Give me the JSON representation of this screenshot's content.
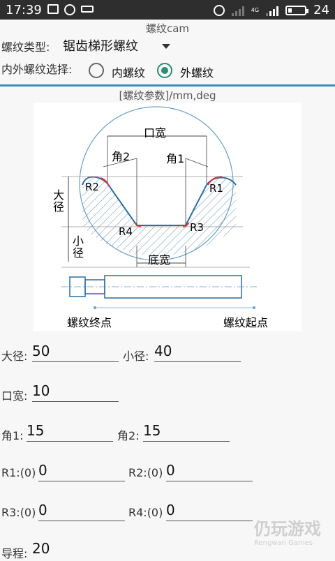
{
  "status_bar": {
    "time": "17:39",
    "battery": "24",
    "network": "4G"
  },
  "app": {
    "title": "螺纹cam"
  },
  "thread_type": {
    "label": "螺纹类型:",
    "value": "锯齿梯形螺纹"
  },
  "side_select": {
    "label": "内外螺纹选择:",
    "options": [
      "内螺纹",
      "外螺纹"
    ],
    "selected": "外螺纹"
  },
  "params_caption": "[螺纹参数]/mm,deg",
  "diagram": {
    "labels": {
      "mouth_width": "口宽",
      "angle2": "角2",
      "angle1": "角1",
      "r2": "R2",
      "r1": "R1",
      "major_dia": "大径",
      "r4": "R4",
      "r3": "R3",
      "minor_dia": "小径",
      "bottom_width": "底宽",
      "thread_end": "螺纹终点",
      "thread_start": "螺纹起点"
    }
  },
  "fields": {
    "major_dia": {
      "label": "大径:",
      "value": "50"
    },
    "minor_dia": {
      "label": "小径:",
      "value": "40"
    },
    "mouth_width": {
      "label": "口宽:",
      "value": "10"
    },
    "angle1": {
      "label": "角1:",
      "value": "15"
    },
    "angle2": {
      "label": "角2:",
      "value": "15"
    },
    "r1": {
      "label": "R1:(0)",
      "value": "0"
    },
    "r2": {
      "label": "R2:(0)",
      "value": "0"
    },
    "r3": {
      "label": "R3:(0)",
      "value": "0"
    },
    "r4": {
      "label": "R4:(0)",
      "value": "0"
    },
    "lead": {
      "label": "导程:",
      "value": "20"
    }
  },
  "watermark": {
    "main": "仍玩游戏",
    "sub": "Rengwan Games"
  },
  "colors": {
    "accent": "#2e8b74",
    "divider": "#3a8fc0",
    "diagram_line": "#2a6fa0",
    "radius_red": "#d33"
  }
}
